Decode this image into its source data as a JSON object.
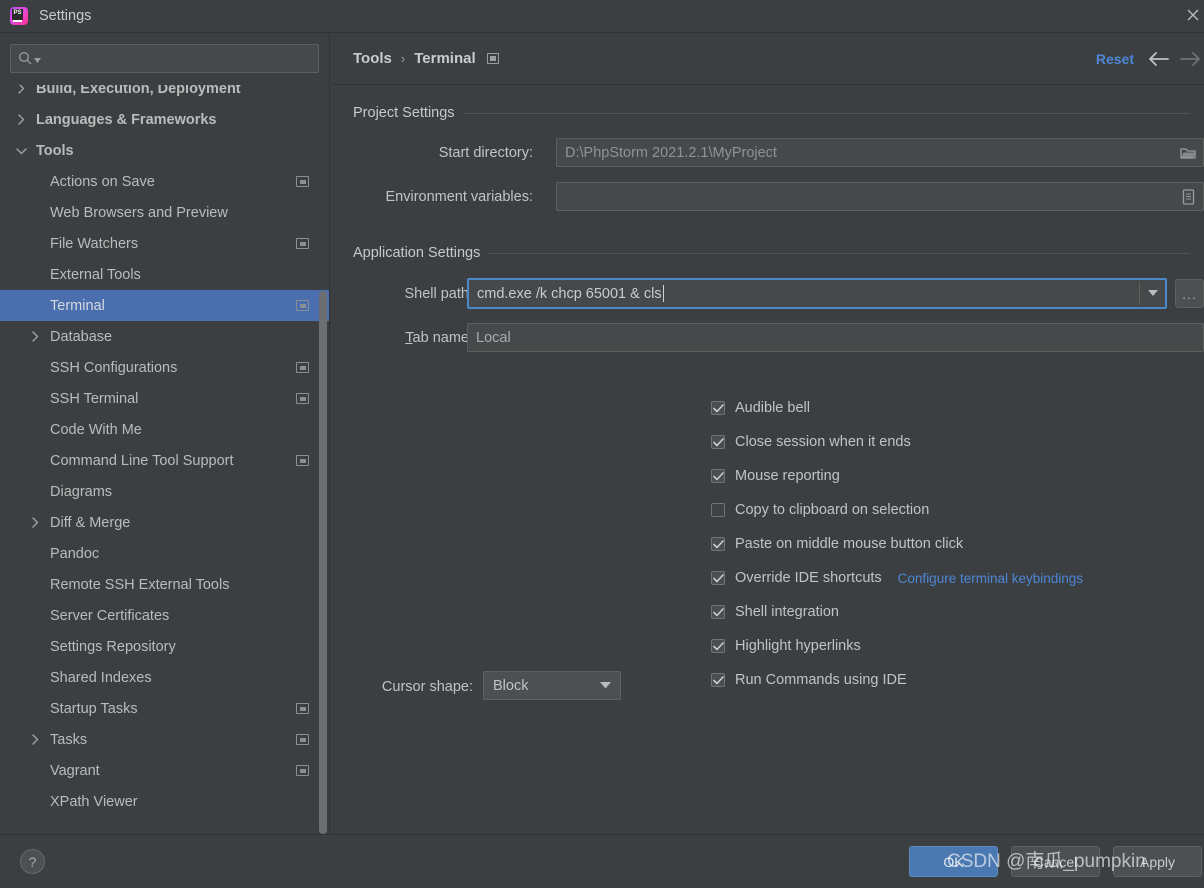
{
  "window": {
    "title": "Settings",
    "logo_text": "PS",
    "close_icon": "close-icon"
  },
  "sidebar": {
    "search": {
      "value": "",
      "placeholder": ""
    },
    "items": [
      {
        "label": "Build, Execution, Deployment",
        "depth": 0,
        "arrow": "collapsed",
        "badge": false,
        "selected": false
      },
      {
        "label": "Languages & Frameworks",
        "depth": 0,
        "arrow": "collapsed",
        "badge": false,
        "selected": false
      },
      {
        "label": "Tools",
        "depth": 0,
        "arrow": "expanded",
        "badge": false,
        "selected": false
      },
      {
        "label": "Actions on Save",
        "depth": 1,
        "arrow": "none",
        "badge": true,
        "selected": false
      },
      {
        "label": "Web Browsers and Preview",
        "depth": 1,
        "arrow": "none",
        "badge": false,
        "selected": false
      },
      {
        "label": "File Watchers",
        "depth": 1,
        "arrow": "none",
        "badge": true,
        "selected": false
      },
      {
        "label": "External Tools",
        "depth": 1,
        "arrow": "none",
        "badge": false,
        "selected": false
      },
      {
        "label": "Terminal",
        "depth": 1,
        "arrow": "none",
        "badge": true,
        "selected": true
      },
      {
        "label": "Database",
        "depth": 1,
        "arrow": "collapsed",
        "badge": false,
        "selected": false
      },
      {
        "label": "SSH Configurations",
        "depth": 1,
        "arrow": "none",
        "badge": true,
        "selected": false
      },
      {
        "label": "SSH Terminal",
        "depth": 1,
        "arrow": "none",
        "badge": true,
        "selected": false
      },
      {
        "label": "Code With Me",
        "depth": 1,
        "arrow": "none",
        "badge": false,
        "selected": false
      },
      {
        "label": "Command Line Tool Support",
        "depth": 1,
        "arrow": "none",
        "badge": true,
        "selected": false
      },
      {
        "label": "Diagrams",
        "depth": 1,
        "arrow": "none",
        "badge": false,
        "selected": false
      },
      {
        "label": "Diff & Merge",
        "depth": 1,
        "arrow": "collapsed",
        "badge": false,
        "selected": false
      },
      {
        "label": "Pandoc",
        "depth": 1,
        "arrow": "none",
        "badge": false,
        "selected": false
      },
      {
        "label": "Remote SSH External Tools",
        "depth": 1,
        "arrow": "none",
        "badge": false,
        "selected": false
      },
      {
        "label": "Server Certificates",
        "depth": 1,
        "arrow": "none",
        "badge": false,
        "selected": false
      },
      {
        "label": "Settings Repository",
        "depth": 1,
        "arrow": "none",
        "badge": false,
        "selected": false
      },
      {
        "label": "Shared Indexes",
        "depth": 1,
        "arrow": "none",
        "badge": false,
        "selected": false
      },
      {
        "label": "Startup Tasks",
        "depth": 1,
        "arrow": "none",
        "badge": true,
        "selected": false
      },
      {
        "label": "Tasks",
        "depth": 1,
        "arrow": "collapsed",
        "badge": true,
        "selected": false
      },
      {
        "label": "Vagrant",
        "depth": 1,
        "arrow": "none",
        "badge": true,
        "selected": false
      },
      {
        "label": "XPath Viewer",
        "depth": 1,
        "arrow": "none",
        "badge": false,
        "selected": false
      }
    ]
  },
  "header": {
    "crumb_root": "Tools",
    "crumb_sep": "›",
    "crumb_leaf": "Terminal",
    "reset_label": "Reset",
    "back_icon": "arrow-left-icon",
    "forward_icon": "arrow-right-icon"
  },
  "project_settings": {
    "section_title": "Project Settings",
    "start_directory": {
      "label": "Start directory:",
      "value": "D:\\PhpStorm 2021.2.1\\MyProject",
      "icon": "folder-icon"
    },
    "environment_variables": {
      "label": "Environment variables:",
      "value": "",
      "icon": "list-document-icon"
    }
  },
  "application_settings": {
    "section_title": "Application Settings",
    "shell_path": {
      "label": "Shell path:",
      "value": "cmd.exe /k chcp 65001 & cls",
      "focused": true,
      "dropdown_icon": "chevron-down-icon",
      "browse_label": "..."
    },
    "tab_name": {
      "label_prefix": "T",
      "label_rest": "ab name:",
      "value": "Local"
    },
    "checkboxes": [
      {
        "label": "Audible bell",
        "checked": true
      },
      {
        "label": "Close session when it ends",
        "checked": true
      },
      {
        "label": "Mouse reporting",
        "checked": true
      },
      {
        "label": "Copy to clipboard on selection",
        "checked": false
      },
      {
        "label": "Paste on middle mouse button click",
        "checked": true
      },
      {
        "label": "Override IDE shortcuts",
        "checked": true,
        "link": "Configure terminal keybindings"
      },
      {
        "label": "Shell integration",
        "checked": true
      },
      {
        "label": "Highlight hyperlinks",
        "checked": true
      },
      {
        "label": "Run Commands using IDE",
        "checked": true
      }
    ],
    "cursor_shape": {
      "label": "Cursor shape:",
      "value": "Block"
    }
  },
  "footer": {
    "help_label": "?",
    "ok_label": "OK",
    "cancel_label": "Cancel",
    "apply_label": "Apply"
  },
  "watermark": {
    "text": "CSDN @南瓜_pumpkin"
  },
  "colors": {
    "accent_blue": "#4b6eaf",
    "link_blue": "#4e86d6",
    "panel_bg": "#3c3f41",
    "field_bg": "#45494a",
    "focus_border": "#4a88c7"
  }
}
